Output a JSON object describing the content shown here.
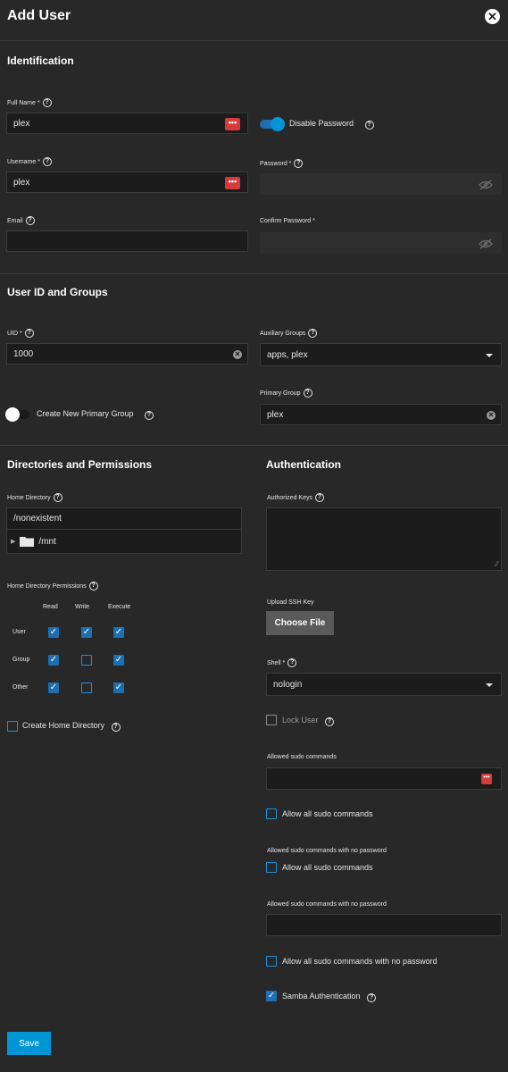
{
  "dialog": {
    "title": "Add User"
  },
  "identification": {
    "heading": "Identification",
    "full_name": {
      "label": "Full Name *",
      "value": "plex"
    },
    "disable_password": {
      "label": "Disable Password",
      "on": true
    },
    "username": {
      "label": "Username *",
      "value": "plex"
    },
    "password": {
      "label": "Password *",
      "value": ""
    },
    "email": {
      "label": "Email",
      "value": ""
    },
    "confirm_password": {
      "label": "Confirm Password *",
      "value": ""
    }
  },
  "uid_groups": {
    "heading": "User ID and Groups",
    "uid": {
      "label": "UID *",
      "value": "1000"
    },
    "aux_groups": {
      "label": "Auxiliary Groups",
      "value": "apps, plex"
    },
    "primary_group": {
      "label": "Primary Group",
      "value": "plex"
    },
    "create_primary_group": {
      "label": "Create New Primary Group",
      "on": false
    }
  },
  "directories": {
    "heading": "Directories and Permissions",
    "home_dir": {
      "label": "Home Directory",
      "value": "/nonexistent",
      "tree_item": "/mnt"
    },
    "perms": {
      "label": "Home Directory Permissions",
      "columns": [
        "Read",
        "Write",
        "Execute"
      ],
      "rows": [
        {
          "name": "User",
          "checks": [
            true,
            true,
            true
          ]
        },
        {
          "name": "Group",
          "checks": [
            true,
            false,
            true
          ]
        },
        {
          "name": "Other",
          "checks": [
            true,
            false,
            true
          ]
        }
      ]
    },
    "create_home": {
      "label": "Create Home Directory",
      "checked": false
    }
  },
  "authentication": {
    "heading": "Authentication",
    "authorized_keys": {
      "label": "Authorized Keys",
      "value": ""
    },
    "upload_ssh": {
      "label": "Upload SSH Key",
      "button": "Choose File"
    },
    "shell": {
      "label": "Shell *",
      "value": "nologin"
    },
    "lock_user": {
      "label": "Lock User",
      "checked": false
    },
    "sudo": {
      "label": "Allowed sudo commands",
      "allow_all": "Allow all sudo commands"
    },
    "sudo_nopass": {
      "label": "Allowed sudo commands with no password",
      "allow_all": "Allow all sudo commands"
    },
    "sudo_nopass2": {
      "label": "Allowed sudo commands with no password",
      "allow_all": "Allow all sudo commands with no password"
    },
    "samba": {
      "label": "Samba Authentication",
      "checked": true
    }
  },
  "footer": {
    "save": "Save"
  },
  "colors": {
    "accent": "#0095d5",
    "danger": "#d63a3a",
    "background": "#282828"
  }
}
